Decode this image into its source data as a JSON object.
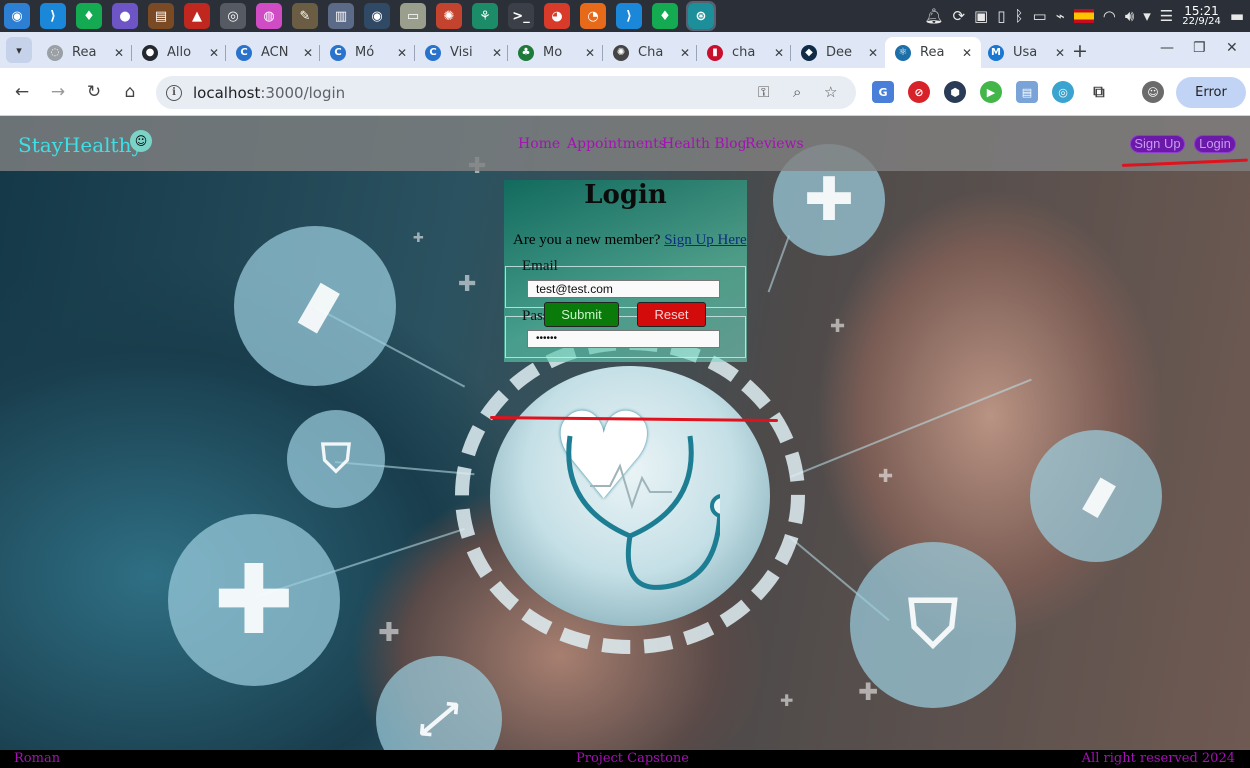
{
  "taskbar": {
    "apps": [
      {
        "icon": "app-launcher-icon",
        "glyph": "◉",
        "color": "#2d7fd4"
      },
      {
        "icon": "vscode-icon",
        "glyph": "⟩",
        "color": "#1a87d8"
      },
      {
        "icon": "mongodb-icon",
        "glyph": "♦",
        "color": "#13aa52"
      },
      {
        "icon": "planet-icon",
        "glyph": "●",
        "color": "#6d55c5"
      },
      {
        "icon": "book-icon",
        "glyph": "▤",
        "color": "#7a4a25"
      },
      {
        "icon": "triangle-app-icon",
        "glyph": "▲",
        "color": "#c0271f"
      },
      {
        "icon": "aperture-icon",
        "glyph": "◎",
        "color": "#555a63"
      },
      {
        "icon": "color-wheel-icon",
        "glyph": "◍",
        "color": "#d04cc5"
      },
      {
        "icon": "gimp-icon",
        "glyph": "✎",
        "color": "#6b5d44"
      },
      {
        "icon": "archive-icon",
        "glyph": "▥",
        "color": "#5b6a87"
      },
      {
        "icon": "disc-icon",
        "glyph": "◉",
        "color": "#304a66"
      },
      {
        "icon": "files-icon",
        "glyph": "▭",
        "color": "#9a9f8d"
      },
      {
        "icon": "photos-icon",
        "glyph": "✺",
        "color": "#c4432e"
      },
      {
        "icon": "git-icon",
        "glyph": "⚘",
        "color": "#1c8b67"
      },
      {
        "icon": "terminal-icon",
        "glyph": ">_",
        "color": "#3b3f47"
      },
      {
        "icon": "chrome-icon",
        "glyph": "◕",
        "color": "#d93b2b"
      },
      {
        "icon": "firefox-icon",
        "glyph": "◔",
        "color": "#e66a1a"
      },
      {
        "icon": "vscode-icon-2",
        "glyph": "⟩",
        "color": "#1a87d8"
      },
      {
        "icon": "mongodb-icon-2",
        "glyph": "♦",
        "color": "#13aa52"
      },
      {
        "icon": "screenshot-app-icon",
        "glyph": "⊛",
        "color": "#1d8f9a"
      }
    ],
    "active_app_index": 19,
    "clock_time": "15:21",
    "clock_date": "22/9/24"
  },
  "tabs": [
    {
      "title": "Rea",
      "fav": "react-icon",
      "fav_glyph": "◌",
      "fav_color": "#9aa0a6"
    },
    {
      "title": "Allo",
      "fav": "github-icon",
      "fav_glyph": "●",
      "fav_color": "#24292f"
    },
    {
      "title": "ACN",
      "fav": "coursera-icon",
      "fav_glyph": "C",
      "fav_color": "#2a73cc"
    },
    {
      "title": "Mó",
      "fav": "coursera-icon",
      "fav_glyph": "C",
      "fav_color": "#2a73cc"
    },
    {
      "title": "Visi",
      "fav": "coursera-icon",
      "fav_glyph": "C",
      "fav_color": "#2a73cc"
    },
    {
      "title": "Mo",
      "fav": "leaf-icon",
      "fav_glyph": "♣",
      "fav_color": "#1d7a3a"
    },
    {
      "title": "Cha",
      "fav": "openai-icon",
      "fav_glyph": "✺",
      "fav_color": "#444"
    },
    {
      "title": "cha",
      "fav": "pin-icon",
      "fav_glyph": "▮",
      "fav_color": "#c8102e"
    },
    {
      "title": "Dee",
      "fav": "deepl-icon",
      "fav_glyph": "◆",
      "fav_color": "#0f2b46"
    },
    {
      "title": "Rea",
      "fav": "react-icon",
      "fav_glyph": "⚛",
      "fav_color": "#1c6fa8"
    },
    {
      "title": "Usa",
      "fav": "mui-icon",
      "fav_glyph": "M",
      "fav_color": "#1976d2"
    }
  ],
  "active_tab_index": 9,
  "address": {
    "host": "localhost",
    "rest": ":3000/login"
  },
  "profile_button_label": "Error",
  "site": {
    "brand": "StayHealthy",
    "nav": [
      "Home",
      "Appointments",
      "Health Blog",
      "Reviews"
    ],
    "signup_label": "Sign Up",
    "login_label": "Login",
    "link_color": "#a511b5",
    "brand_color": "#3de0e6"
  },
  "login_form": {
    "title": "Login",
    "member_prompt": "Are you a new member?",
    "signup_link": "Sign Up Here",
    "email_legend": "Email",
    "email_value": "test@test.com",
    "password_legend": "Password",
    "password_value": "••••••",
    "submit_label": "Submit",
    "reset_label": "Reset",
    "submit_color": "#0a7a0a",
    "reset_color": "#d40b0b"
  },
  "footer": {
    "left": "Roman",
    "center": "Project Capstone",
    "right": "All right reserved 2024"
  }
}
